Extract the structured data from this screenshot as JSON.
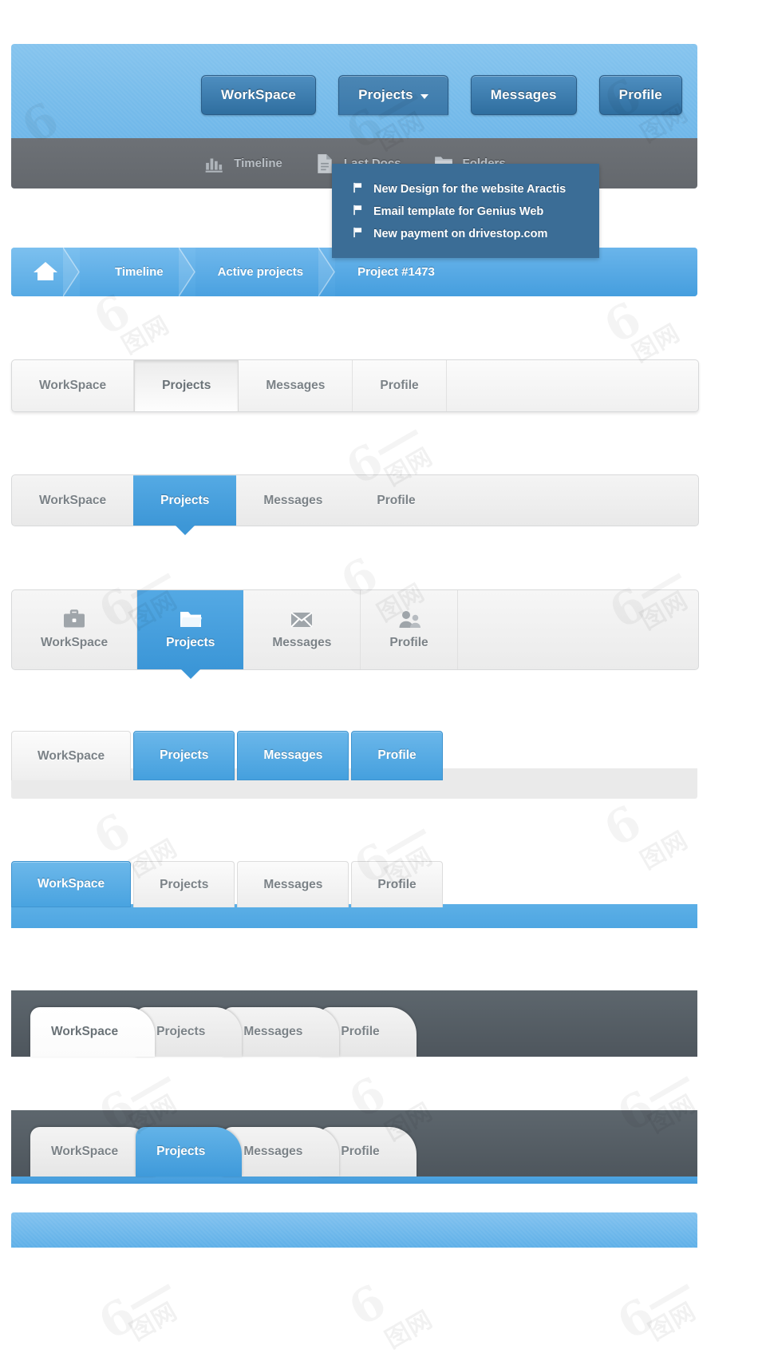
{
  "header": {
    "buttons": [
      {
        "label": "WorkSpace",
        "state": "normal"
      },
      {
        "label": "Projects",
        "state": "open",
        "icon": "chevron-down-icon"
      },
      {
        "label": "Messages",
        "state": "normal"
      },
      {
        "label": "Profile",
        "state": "normal"
      }
    ],
    "dropdown": {
      "items": [
        {
          "icon": "flag-icon",
          "label": "New Design for the website Aractis"
        },
        {
          "icon": "flag-icon",
          "label": "Email template for Genius Web"
        },
        {
          "icon": "flag-icon",
          "label": "New payment on drivestop.com"
        }
      ]
    },
    "subnav": [
      {
        "icon": "chart-bars-icon",
        "label": "Timeline"
      },
      {
        "icon": "document-icon",
        "label": "Last Docs"
      },
      {
        "icon": "folder-icon",
        "label": "Folders"
      }
    ]
  },
  "breadcrumb": {
    "home_icon": "home-icon",
    "items": [
      {
        "label": "Timeline",
        "active": false
      },
      {
        "label": "Active projects",
        "active": false
      },
      {
        "label": "Project #1473",
        "active": true
      }
    ]
  },
  "tabs_plain": {
    "items": [
      {
        "label": "WorkSpace",
        "active": false
      },
      {
        "label": "Projects",
        "active": true
      },
      {
        "label": "Messages",
        "active": false
      },
      {
        "label": "Profile",
        "active": false
      }
    ]
  },
  "tabs_blue": {
    "items": [
      {
        "label": "WorkSpace",
        "active": false
      },
      {
        "label": "Projects",
        "active": true
      },
      {
        "label": "Messages",
        "active": false
      },
      {
        "label": "Profile",
        "active": false
      }
    ]
  },
  "tabs_icons": {
    "items": [
      {
        "label": "WorkSpace",
        "icon": "briefcase-icon",
        "active": false
      },
      {
        "label": "Projects",
        "icon": "folder-icon",
        "active": true
      },
      {
        "label": "Messages",
        "icon": "envelope-icon",
        "active": false
      },
      {
        "label": "Profile",
        "icon": "users-icon",
        "active": false
      }
    ]
  },
  "tabs_buttons": {
    "items": [
      {
        "label": "WorkSpace",
        "active": false
      },
      {
        "label": "Projects",
        "active": true
      },
      {
        "label": "Messages",
        "active": true
      },
      {
        "label": "Profile",
        "active": true
      }
    ]
  },
  "tabs_workspace": {
    "items": [
      {
        "label": "WorkSpace",
        "active": true
      },
      {
        "label": "Projects",
        "active": false
      },
      {
        "label": "Messages",
        "active": false
      },
      {
        "label": "Profile",
        "active": false
      }
    ]
  },
  "tabs_dark_a": {
    "items": [
      {
        "label": "WorkSpace",
        "active": true
      },
      {
        "label": "Projects",
        "active": false
      },
      {
        "label": "Messages",
        "active": false
      },
      {
        "label": "Profile",
        "active": false
      }
    ]
  },
  "tabs_dark_b": {
    "items": [
      {
        "label": "WorkSpace",
        "active": false
      },
      {
        "label": "Projects",
        "active": true
      },
      {
        "label": "Messages",
        "active": false
      },
      {
        "label": "Profile",
        "active": false
      }
    ]
  },
  "colors": {
    "accent_blue": "#4ea6e2",
    "header_blue": "#79bdeb",
    "dropdown_blue": "#3b6d96",
    "dark_gray": "#5d666d",
    "subnav_gray": "#686c71",
    "button_blue_dark": "#2f6e9f",
    "tab_gray_text": "#7b8287"
  }
}
